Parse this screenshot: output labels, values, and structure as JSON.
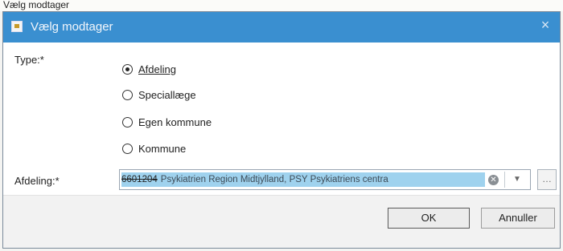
{
  "top_strip_text": "Vælg modtager",
  "dialog": {
    "title": "Vælg modtager",
    "close_glyph": "×",
    "title_bar_color": "#3a8fd0"
  },
  "type": {
    "label": "Type:*",
    "options": [
      {
        "label": "Afdeling",
        "selected": true
      },
      {
        "label": "Speciallæge",
        "selected": false
      },
      {
        "label": "Egen kommune",
        "selected": false
      },
      {
        "label": "Kommune",
        "selected": false
      }
    ]
  },
  "afdeling": {
    "label": "Afdeling:*",
    "code": "6601204",
    "value": "Psykiatrien Region Midtjylland, PSY Psykiatriens centra"
  },
  "buttons": {
    "ok": "OK",
    "cancel": "Annuller"
  }
}
